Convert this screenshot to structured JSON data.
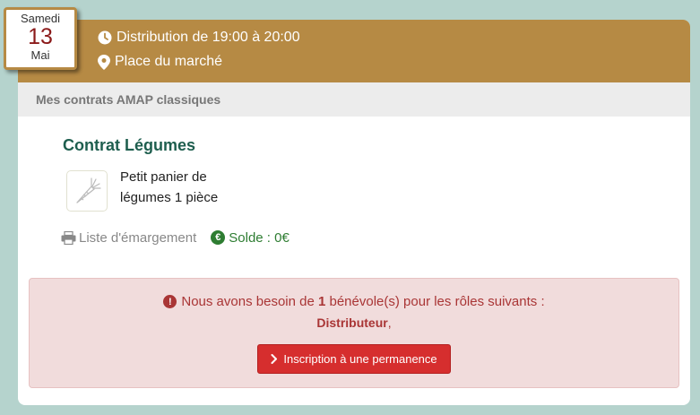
{
  "date": {
    "weekday": "Samedi",
    "day": "13",
    "month": "Mai"
  },
  "header": {
    "distribution_time": "Distribution de 19:00 à 20:00",
    "place": "Place du marché"
  },
  "subheader": "Mes contrats AMAP classiques",
  "contract": {
    "title": "Contrat Légumes",
    "product_line1": "Petit panier de",
    "product_line2": "légumes 1 pièce",
    "product_icon": "carrot-icon"
  },
  "links": {
    "attendance": "Liste d'émargement",
    "balance": "Solde : 0€"
  },
  "alert": {
    "prefix": "Nous avons besoin de ",
    "count": "1",
    "suffix": " bénévole(s) pour les rôles suivants :",
    "role": "Distributeur",
    "role_suffix": ",",
    "button": "Inscription à une permanence"
  },
  "colors": {
    "background": "#b5d3cd",
    "header": "#b68a44",
    "title": "#1e5e4e",
    "alert_bg": "#f1dcdc",
    "alert_text": "#a93535",
    "button": "#d62e2e",
    "balance": "#2e7d32"
  }
}
